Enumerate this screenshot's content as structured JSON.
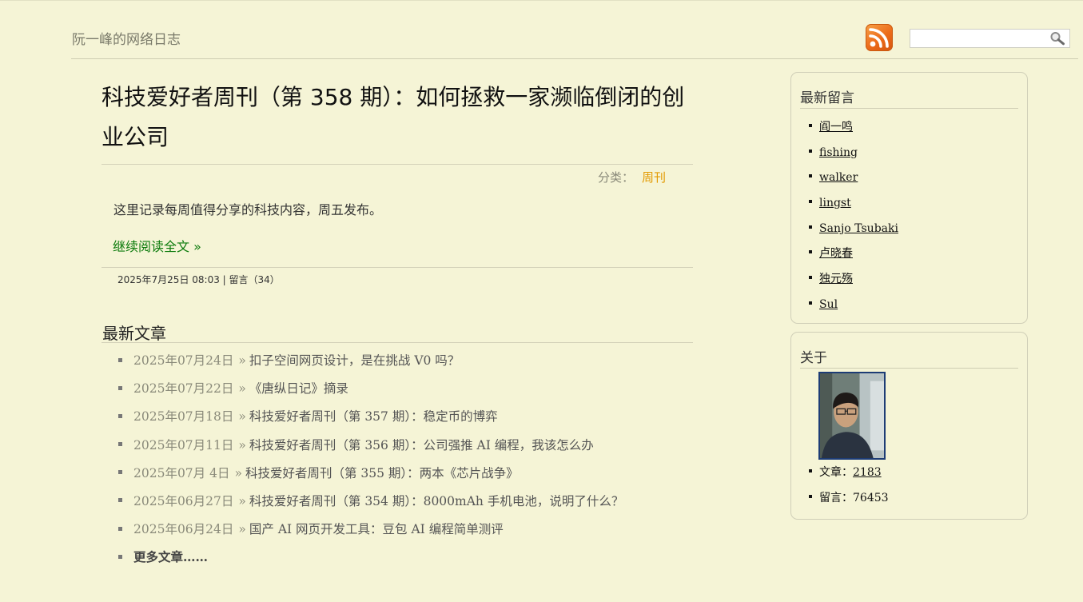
{
  "header": {
    "site_title": "阮一峰的网络日志",
    "search_placeholder": ""
  },
  "post": {
    "title": "科技爱好者周刊（第 358 期）：如何拯救一家濒临倒闭的创业公司",
    "category_label": "分类：",
    "category": "周刊",
    "summary": "这里记录每周值得分享的科技内容，周五发布。",
    "read_more": "继续阅读全文 »",
    "date": "2025年7月25日 08:03",
    "comments_sep": " | ",
    "comments": "留言（34）"
  },
  "recent": {
    "title": "最新文章",
    "sep": "»",
    "items": [
      {
        "date": "2025年07月24日",
        "title": "扣子空间网页设计，是在挑战 V0 吗？"
      },
      {
        "date": "2025年07月22日",
        "title": "《唐纵日记》摘录"
      },
      {
        "date": "2025年07月18日",
        "title": "科技爱好者周刊（第 357 期）：稳定币的博弈"
      },
      {
        "date": "2025年07月11日",
        "title": "科技爱好者周刊（第 356 期）：公司强推 AI 编程，我该怎么办"
      },
      {
        "date": "2025年07月 4日",
        "title": "科技爱好者周刊（第 355 期）：两本《芯片战争》"
      },
      {
        "date": "2025年06月27日",
        "title": "科技爱好者周刊（第 354 期）：8000mAh 手机电池，说明了什么？"
      },
      {
        "date": "2025年06月24日",
        "title": "国产 AI 网页开发工具：豆包 AI 编程简单测评"
      }
    ],
    "more": "更多文章……"
  },
  "sidebar": {
    "comments_title": "最新留言",
    "commenters": [
      "阎一鸣",
      "fishing",
      "walker",
      "lingst",
      "Sanjo Tsubaki",
      "卢晓春",
      "独元殇",
      "Sul"
    ],
    "about_title": "关于",
    "articles_label": "文章：",
    "articles_count": "2183",
    "comments_label": "留言：",
    "comments_count": "76453"
  },
  "colors": {
    "background": "#f5f4d6",
    "category_link": "#e39a00",
    "read_more": "#0b7a0b",
    "rss": "#ec6b1a"
  }
}
